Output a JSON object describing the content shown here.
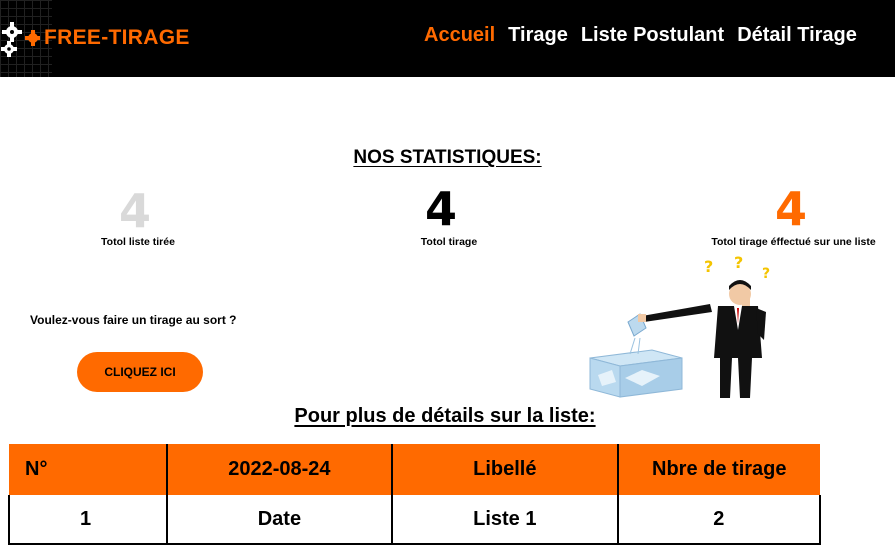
{
  "header": {
    "brand": "FREE-TIRAGE",
    "nav": [
      {
        "label": "Accueil",
        "active": true
      },
      {
        "label": "Tirage",
        "active": false
      },
      {
        "label": "Liste Postulant",
        "active": false
      },
      {
        "label": "Détail Tirage",
        "active": false
      }
    ]
  },
  "stats": {
    "title": "NOS STATISTIQUES:",
    "items": [
      {
        "value": "4",
        "label": "Totol liste tirée"
      },
      {
        "value": "4",
        "label": "Totol  tirage"
      },
      {
        "value": "4",
        "label": "Totol  tirage éffectué sur une liste"
      }
    ]
  },
  "cta": {
    "question": "Voulez-vous faire un tirage au sort ?",
    "button_label": "CLIQUEZ ICI"
  },
  "details": {
    "title": "Pour plus de détails sur la liste:",
    "columns": [
      "N°",
      "2022-08-24",
      "Libellé",
      "Nbre de tirage"
    ],
    "rows": [
      [
        "1",
        "Date",
        "Liste 1",
        "2"
      ]
    ]
  },
  "colors": {
    "accent": "#ff6a00",
    "header_bg": "#000000",
    "stat1": "#d9d9d9",
    "stat2": "#000000",
    "stat3": "#ff6a00"
  }
}
